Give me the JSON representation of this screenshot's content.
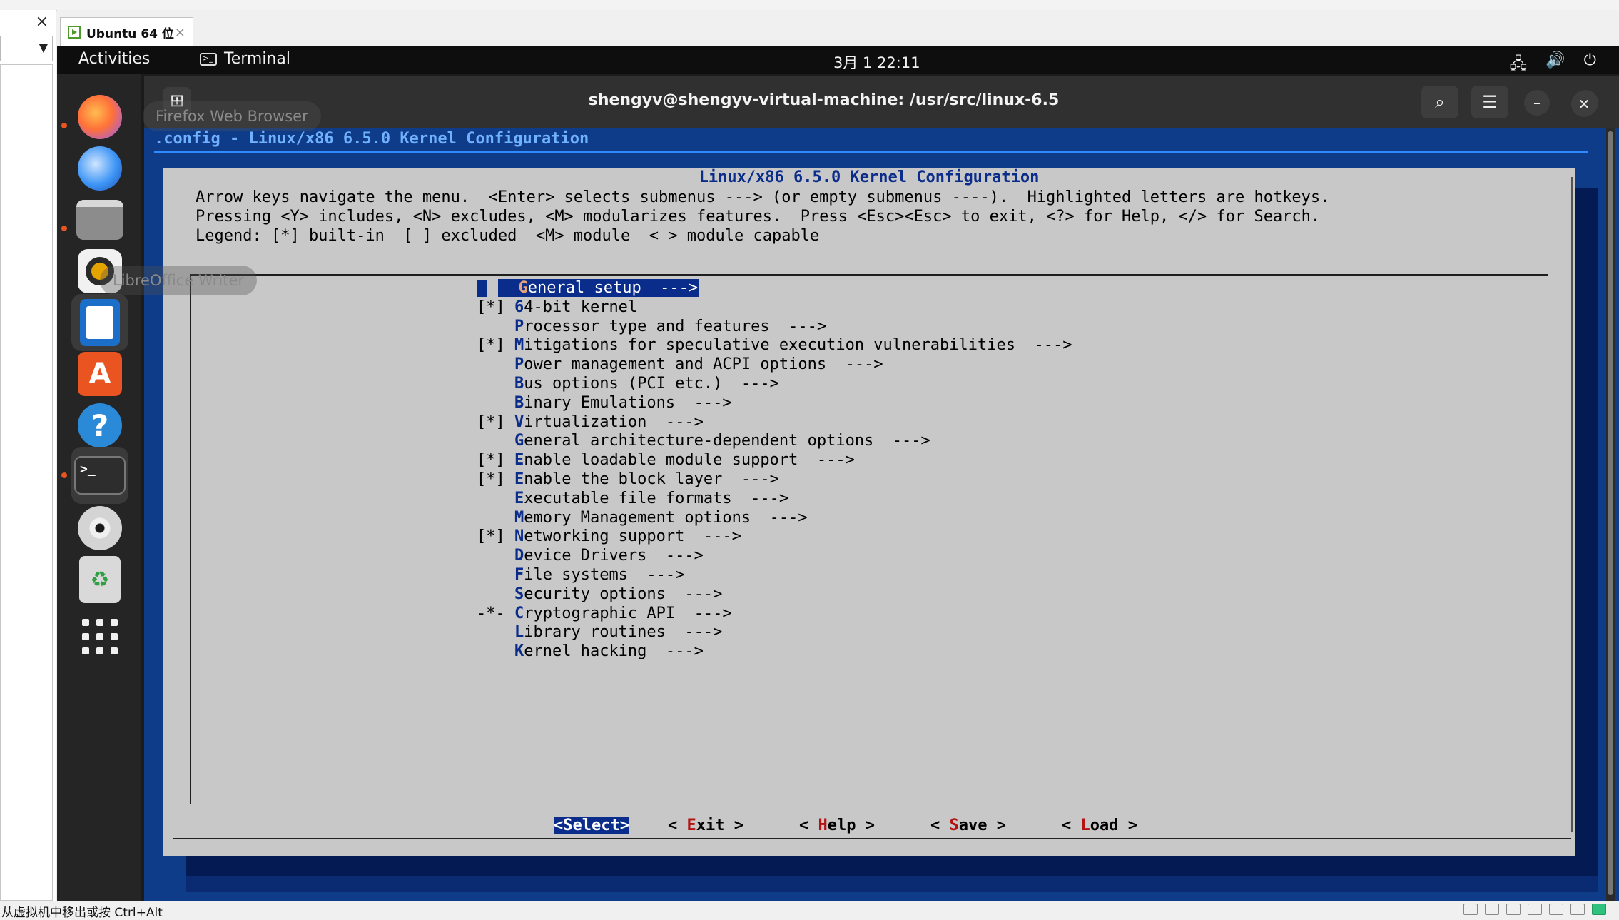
{
  "host": {
    "close_glyph": "×",
    "tab_label": "Ubuntu 64 位",
    "tab_close": "×",
    "status_text": "从虚拟机中移出或按 Ctrl+Alt"
  },
  "topbar": {
    "activities": "Activities",
    "app_name": "Terminal",
    "clock": "3月 1  22:11"
  },
  "dock": {
    "tooltips": [
      "Firefox Web Browser",
      "LibreOffice Writer"
    ],
    "items": [
      {
        "name": "firefox",
        "icon": "firefox-icon"
      },
      {
        "name": "thunderbird",
        "icon": "thunderbird-icon"
      },
      {
        "name": "files",
        "icon": "folder-icon"
      },
      {
        "name": "rhythmbox",
        "icon": "speaker-icon"
      },
      {
        "name": "libreoffice-writer",
        "icon": "document-icon"
      },
      {
        "name": "app-center",
        "icon": "store-icon"
      },
      {
        "name": "help",
        "icon": "help-icon"
      },
      {
        "name": "terminal",
        "icon": "terminal-icon"
      },
      {
        "name": "dvd",
        "icon": "disc-icon"
      },
      {
        "name": "trash",
        "icon": "recycle-icon"
      },
      {
        "name": "show-apps",
        "icon": "app-grid-icon"
      }
    ]
  },
  "terminal": {
    "title": "shengyv@shengyv-virtual-machine: /usr/src/linux-6.5"
  },
  "menuconfig": {
    "header": ".config - Linux/x86 6.5.0 Kernel Configuration",
    "dialog_title": "Linux/x86 6.5.0 Kernel Configuration",
    "help_lines": [
      "Arrow keys navigate the menu.  <Enter> selects submenus ---> (or empty submenus ----).  Highlighted letters are hotkeys.",
      "Pressing <Y> includes, <N> excludes, <M> modularizes features.  Press <Esc><Esc> to exit, <?> for Help, </> for Search.",
      "Legend: [*] built-in  [ ] excluded  <M> module  < > module capable"
    ],
    "items": [
      {
        "prefix": "",
        "hotkey": "G",
        "rest": "eneral setup  --->",
        "selected": true
      },
      {
        "prefix": "[*] ",
        "hotkey": "6",
        "rest": "4-bit kernel"
      },
      {
        "prefix": "    ",
        "hotkey": "P",
        "rest": "rocessor type and features  --->"
      },
      {
        "prefix": "[*] ",
        "hotkey": "M",
        "rest": "itigations for speculative execution vulnerabilities  --->"
      },
      {
        "prefix": "    ",
        "hotkey": "P",
        "rest": "ower management and ACPI options  --->"
      },
      {
        "prefix": "    ",
        "hotkey": "B",
        "rest": "us options (PCI etc.)  --->"
      },
      {
        "prefix": "    ",
        "hotkey": "B",
        "rest": "inary Emulations  --->"
      },
      {
        "prefix": "[*] ",
        "hotkey": "V",
        "rest": "irtualization  --->"
      },
      {
        "prefix": "    ",
        "hotkey": "G",
        "rest": "eneral architecture-dependent options  --->"
      },
      {
        "prefix": "[*] ",
        "hotkey": "E",
        "rest": "nable loadable module support  --->"
      },
      {
        "prefix": "[*] ",
        "hotkey": "E",
        "rest": "nable the block layer  --->"
      },
      {
        "prefix": "    ",
        "hotkey": "E",
        "rest": "xecutable file formats  --->"
      },
      {
        "prefix": "    ",
        "hotkey": "M",
        "rest": "emory Management options  --->"
      },
      {
        "prefix": "[*] ",
        "hotkey": "N",
        "rest": "etworking support  --->"
      },
      {
        "prefix": "    ",
        "hotkey": "D",
        "rest": "evice Drivers  --->"
      },
      {
        "prefix": "    ",
        "hotkey": "F",
        "rest": "ile systems  --->"
      },
      {
        "prefix": "    ",
        "hotkey": "S",
        "rest": "ecurity options  --->"
      },
      {
        "prefix": "-*- ",
        "hotkey": "C",
        "rest": "ryptographic API  --->"
      },
      {
        "prefix": "    ",
        "hotkey": "L",
        "rest": "ibrary routines  --->"
      },
      {
        "prefix": "    ",
        "hotkey": "K",
        "rest": "ernel hacking  --->"
      }
    ],
    "buttons": [
      {
        "open": "<",
        "hotkey": "S",
        "rest": "elect",
        "close": ">",
        "selected": true
      },
      {
        "open": "< ",
        "hotkey": "E",
        "rest": "xit",
        "close": " >"
      },
      {
        "open": "< ",
        "hotkey": "H",
        "rest": "elp",
        "close": " >"
      },
      {
        "open": "< ",
        "hotkey": "S",
        "rest": "ave",
        "close": " >"
      },
      {
        "open": "< ",
        "hotkey": "L",
        "rest": "oad",
        "close": " >"
      }
    ]
  }
}
